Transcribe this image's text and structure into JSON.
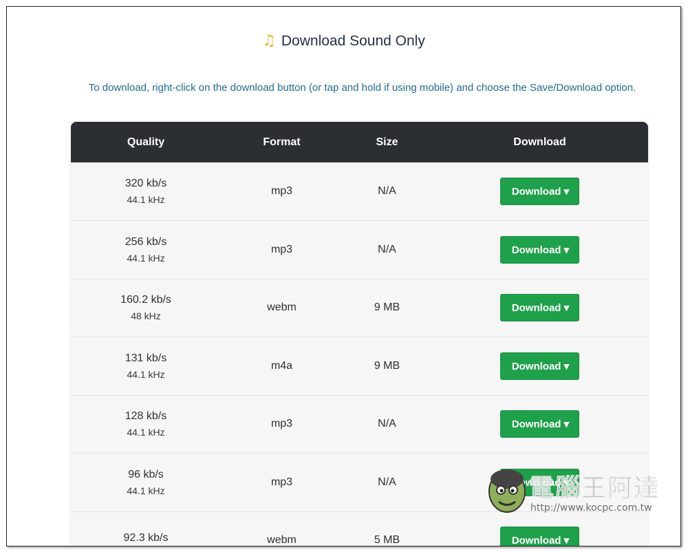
{
  "header": {
    "title": "Download Sound Only",
    "title_icon": "music-note-icon",
    "instruction": "To download, right-click on the download button (or tap and hold if using mobile) and choose the Save/Download option."
  },
  "table": {
    "columns": [
      "Quality",
      "Format",
      "Size",
      "Download"
    ],
    "rows": [
      {
        "bitrate": "320 kb/s",
        "rate": "44.1 kHz",
        "format": "mp3",
        "size": "N/A",
        "button": "Download ▾"
      },
      {
        "bitrate": "256 kb/s",
        "rate": "44.1 kHz",
        "format": "mp3",
        "size": "N/A",
        "button": "Download ▾"
      },
      {
        "bitrate": "160.2 kb/s",
        "rate": "48 kHz",
        "format": "webm",
        "size": "9 MB",
        "button": "Download ▾"
      },
      {
        "bitrate": "131 kb/s",
        "rate": "44.1 kHz",
        "format": "m4a",
        "size": "9 MB",
        "button": "Download ▾"
      },
      {
        "bitrate": "128 kb/s",
        "rate": "44.1 kHz",
        "format": "mp3",
        "size": "N/A",
        "button": "Download ▾"
      },
      {
        "bitrate": "96 kb/s",
        "rate": "44.1 kHz",
        "format": "mp3",
        "size": "N/A",
        "button": "Download ▾"
      },
      {
        "bitrate": "92.3 kb/s",
        "rate": "",
        "format": "webm",
        "size": "5 MB",
        "button": "Download ▾"
      }
    ]
  },
  "watermark": {
    "name": "電腦王阿達",
    "url": "http://www.kocpc.com.tw"
  },
  "colors": {
    "header_bg": "#2b2f33",
    "button_green": "#1fa04a",
    "instruction_blue": "#1e6b93"
  }
}
